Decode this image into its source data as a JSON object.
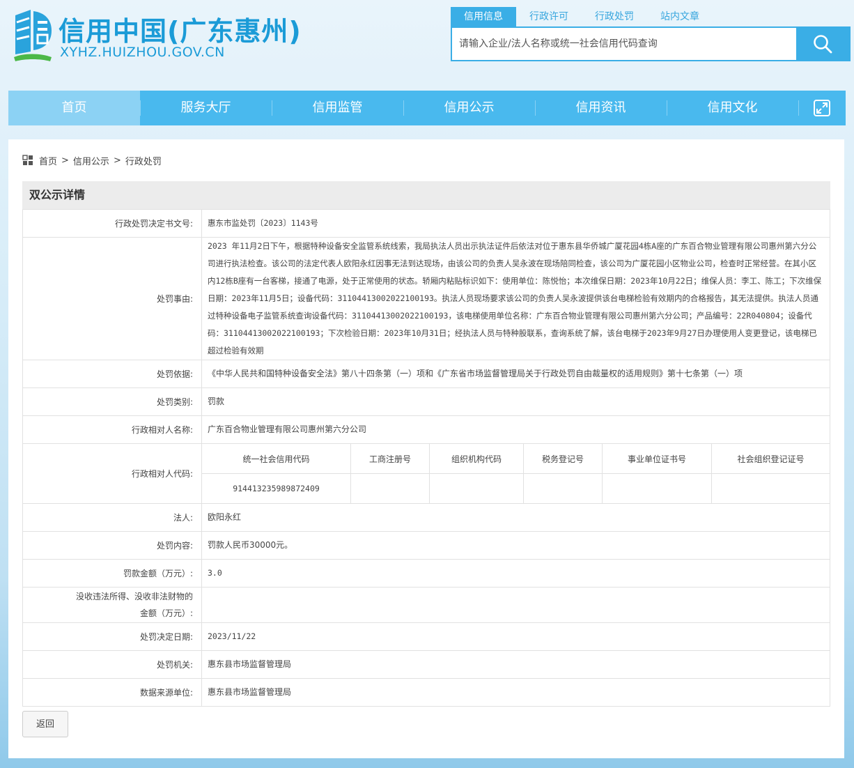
{
  "site": {
    "title": "信用中国(广东惠州)",
    "url": "XYHZ.HUIZHOU.GOV.CN"
  },
  "search": {
    "tabs": [
      "信用信息",
      "行政许可",
      "行政处罚",
      "站内文章"
    ],
    "active_tab": 0,
    "placeholder": "请输入企业/法人名称或统一社会信用代码查询"
  },
  "nav": {
    "items": [
      "首页",
      "服务大厅",
      "信用监管",
      "信用公示",
      "信用资讯",
      "信用文化"
    ],
    "active": 0
  },
  "breadcrumb": [
    "首页",
    "信用公示",
    "行政处罚"
  ],
  "section_title": "双公示详情",
  "detail": {
    "doc_no_label": "行政处罚决定书文号:",
    "doc_no": "惠东市监处罚〔2023〕1143号",
    "reason_label": "处罚事由:",
    "reason": "2023 年11月2日下午，根据特种设备安全监管系统线索，我局执法人员出示执法证件后依法对位于惠东县华侨城广厦花园4栋A座的广东百合物业管理有限公司惠州第六分公司进行执法检查。该公司的法定代表人欧阳永红因事无法到达现场，由该公司的负责人吴永波在现场陪同检查，该公司为广厦花园小区物业公司，检查时正常经营。在其小区内12栋B座有一台客梯，接通了电源，处于正常使用的状态。轿厢内粘贴标识如下：使用单位：陈悦怡；本次维保日期：2023年10月22日；维保人员：李工、陈工；下次维保日期：2023年11月5日；设备代码：31104413002022100193。执法人员现场要求该公司的负责人吴永波提供该台电梯检验有效期内的合格报告，其无法提供。执法人员通过特种设备电子监管系统查询设备代码：31104413002022100193，该电梯使用单位名称：广东百合物业管理有限公司惠州第六分公司；产品编号：22R040804；设备代码：31104413002022100193；下次检验日期：2023年10月31日；经执法人员与特种股联系，查询系统了解，该台电梯于2023年9月27日办理使用人变更登记，该电梯已超过检验有效期",
    "basis_label": "处罚依据:",
    "basis": "《中华人民共和国特种设备安全法》第八十四条第（一）项和《广东省市场监督管理局关于行政处罚自由裁量权的适用规则》第十七条第（一）项",
    "category_label": "处罚类别:",
    "category": "罚款",
    "party_name_label": "行政相对人名称:",
    "party_name": "广东百合物业管理有限公司惠州第六分公司",
    "party_code_label": "行政相对人代码:",
    "code_headers": [
      "统一社会信用代码",
      "工商注册号",
      "组织机构代码",
      "税务登记号",
      "事业单位证书号",
      "社会组织登记证号"
    ],
    "code_values": [
      "914413235989872409",
      "",
      "",
      "",
      "",
      ""
    ],
    "legal_person_label": "法人:",
    "legal_person": "欧阳永红",
    "content_label": "处罚内容:",
    "content": "罚款人民币30000元。",
    "amount_label": "罚款金额（万元）:",
    "amount": "3.0",
    "confiscation_label_1": "没收违法所得、没收非法财物的",
    "confiscation_label_2": "金额（万元）:",
    "confiscation": "",
    "date_label": "处罚决定日期:",
    "date": "2023/11/22",
    "authority_label": "处罚机关:",
    "authority": "惠东县市场监督管理局",
    "source_label": "数据来源单位:",
    "source": "惠东县市场监督管理局"
  },
  "back_label": "返回",
  "colors": {
    "brand": "#1b9bd7",
    "nav": "#49b9ee",
    "nav_active": "#8cd2f4",
    "search_accent": "#3aaee6"
  },
  "icons": [
    "logo-icon",
    "search-icon",
    "fullscreen-icon",
    "grid-icon"
  ]
}
